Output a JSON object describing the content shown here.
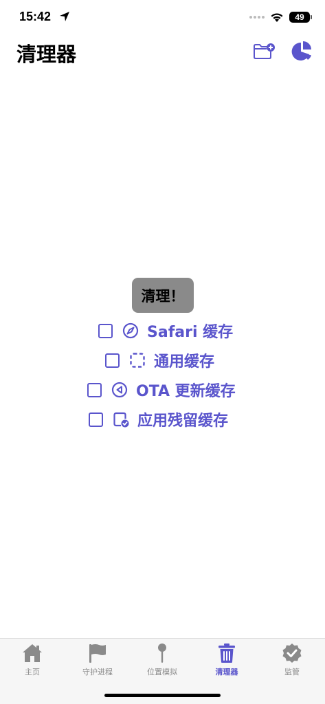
{
  "status_bar": {
    "time": "15:42",
    "battery": "49",
    "icons": [
      "location-arrow-icon",
      "signal-icon",
      "wifi-icon",
      "battery-icon"
    ]
  },
  "nav": {
    "title": "清理器",
    "actions": [
      "folder-add-icon",
      "pie-chart-icon"
    ]
  },
  "main": {
    "clean_button": "清理！",
    "options": [
      {
        "label": "Safari 缓存",
        "icon": "compass-icon",
        "checked": false
      },
      {
        "label": "通用缓存",
        "icon": "dashed-square-icon",
        "checked": false
      },
      {
        "label": "OTA 更新缓存",
        "icon": "back-circle-icon",
        "checked": false
      },
      {
        "label": "应用残留缓存",
        "icon": "app-checkmark-icon",
        "checked": false
      }
    ]
  },
  "tab_bar": {
    "items": [
      {
        "label": "主页",
        "icon": "house-icon",
        "active": false
      },
      {
        "label": "守护进程",
        "icon": "flag-icon",
        "active": false
      },
      {
        "label": "位置模拟",
        "icon": "pin-icon",
        "active": false
      },
      {
        "label": "清理器",
        "icon": "trash-icon",
        "active": true
      },
      {
        "label": "监管",
        "icon": "checkmark-seal-icon",
        "active": false
      }
    ]
  },
  "colors": {
    "accent": "#5a55cc",
    "button_bg": "#8a8a8a",
    "tab_inactive": "#8a8a8a",
    "tab_bar_bg": "#f6f6f6"
  }
}
